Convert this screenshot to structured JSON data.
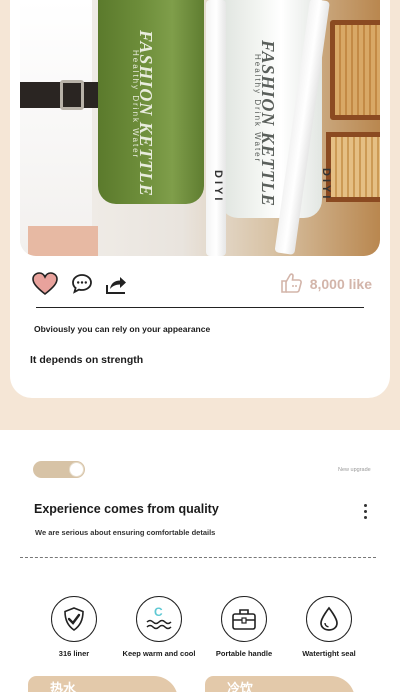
{
  "photo": {
    "bottle_green_text": "FASHION KETTLE",
    "bottle_green_subtext": "Healthy Drink Water",
    "bottle_white_text": "FASHION KETTLE",
    "bottle_white_subtext": "Healthy Drink Water",
    "strap_left_text": "DIYI",
    "strap_right_text": "DIYI"
  },
  "actions": {
    "like_count": "8,000 like"
  },
  "captions": {
    "line1": "Obviously you can rely on your appearance",
    "line2": "It depends on strength"
  },
  "section2": {
    "badge": "New upgrade",
    "title": "Experience comes from quality",
    "subtitle": "We are serious about ensuring comfortable details"
  },
  "features": [
    {
      "icon": "shield-check-icon",
      "label": "316 liner"
    },
    {
      "icon": "warm-cool-icon",
      "label": "Keep warm and cool"
    },
    {
      "icon": "handle-bag-icon",
      "label": "Portable handle"
    },
    {
      "icon": "water-drop-icon",
      "label": "Watertight seal"
    }
  ],
  "bottom_tabs": [
    {
      "label": "热水"
    },
    {
      "label": "冷饮"
    }
  ],
  "colors": {
    "background": "#f5e6d6",
    "heart": "#d98c86",
    "accent_beige": "#d7c3a6",
    "cool_accent": "#5ec8d3"
  }
}
